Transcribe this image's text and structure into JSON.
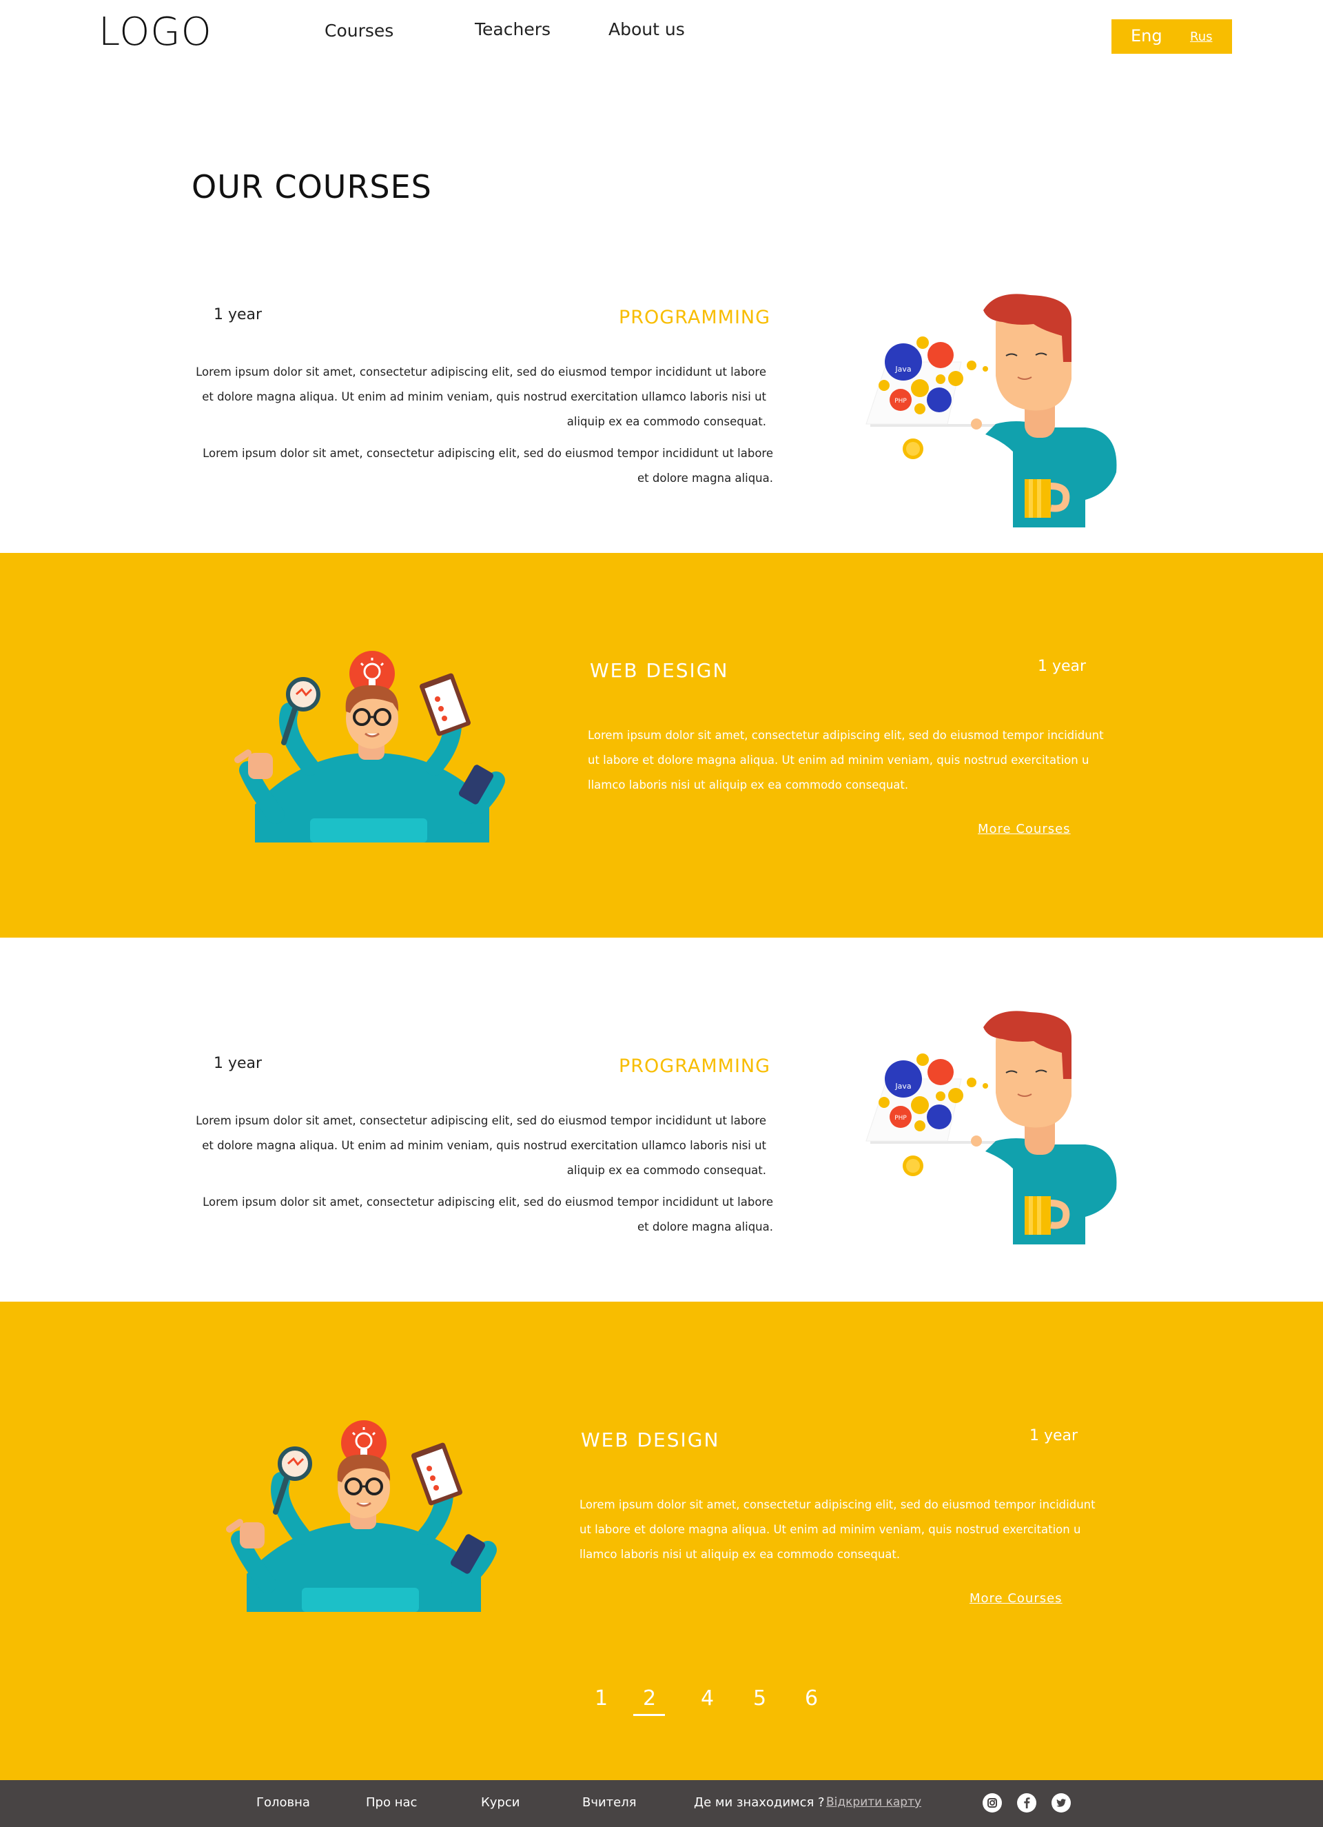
{
  "header": {
    "logo": "LOGO",
    "nav": [
      "Courses",
      "Teachers",
      "About us"
    ],
    "lang_active": "Eng",
    "lang_other": "Rus"
  },
  "page_title": "OUR COURSES",
  "courses": [
    {
      "title": "PROGRAMMING",
      "duration": "1 year",
      "para1_lines": [
        "Lorem ipsum dolor sit amet, consectetur adipiscing elit, sed  do eiusmod tempor incididunt ut labore",
        "et dolore magna aliqua. Ut enim ad minim veniam, quis nostrud exercitation ullamco laboris nisi ut",
        "aliquip ex ea commodo consequat."
      ],
      "para2_lines": [
        "Lorem ipsum dolor sit amet, consectetur adipiscing elit, sed  do eiusmod tempor incididunt ut labore",
        "et dolore magna aliqua."
      ]
    },
    {
      "title": "WEB  DESIGN",
      "duration": "1 year",
      "para_lines": [
        "Lorem ipsum dolor sit amet, consectetur adipiscing elit, sed  do eiusmod tempor incididunt",
        "ut labore  et dolore magna aliqua. Ut enim ad minim veniam, quis nostrud exercitation u",
        "llamco laboris nisi ut  aliquip ex ea commodo consequat."
      ],
      "link": "More  Courses"
    },
    {
      "title": "PROGRAMMING",
      "duration": "1 year",
      "para1_lines": [
        "Lorem ipsum dolor sit amet, consectetur adipiscing elit, sed  do eiusmod tempor incididunt ut labore",
        "et dolore magna aliqua. Ut enim ad minim veniam, quis nostrud exercitation ullamco laboris nisi ut",
        "aliquip ex ea commodo consequat."
      ],
      "para2_lines": [
        "Lorem ipsum dolor sit amet, consectetur adipiscing elit, sed  do eiusmod tempor incididunt ut labore",
        "et dolore magna aliqua."
      ]
    },
    {
      "title": "WEB  DESIGN",
      "duration": "1 year",
      "para_lines": [
        "Lorem ipsum dolor sit amet, consectetur adipiscing elit, sed  do eiusmod tempor incididunt",
        "ut labore  et dolore magna aliqua. Ut enim ad minim veniam, quis nostrud exercitation u",
        "llamco laboris nisi ut  aliquip ex ea commodo consequat."
      ],
      "link": "More  Courses"
    }
  ],
  "illustration_labels": {
    "java": "Java",
    "php": "PHP"
  },
  "pagination": {
    "pages": [
      "1",
      "2",
      "4",
      "5",
      "6"
    ],
    "current": "2"
  },
  "footer": {
    "links": [
      "Головна",
      "Про нас",
      "Курси",
      "Вчителя"
    ],
    "where_label": "Де  ми  знаходимся ?",
    "map_link": "Відкрити карту",
    "social_icons": [
      "instagram-icon",
      "facebook-icon",
      "twitter-icon"
    ]
  },
  "colors": {
    "accent": "#f8bd00",
    "footer_bg": "#484444",
    "text_dark": "#222222"
  }
}
